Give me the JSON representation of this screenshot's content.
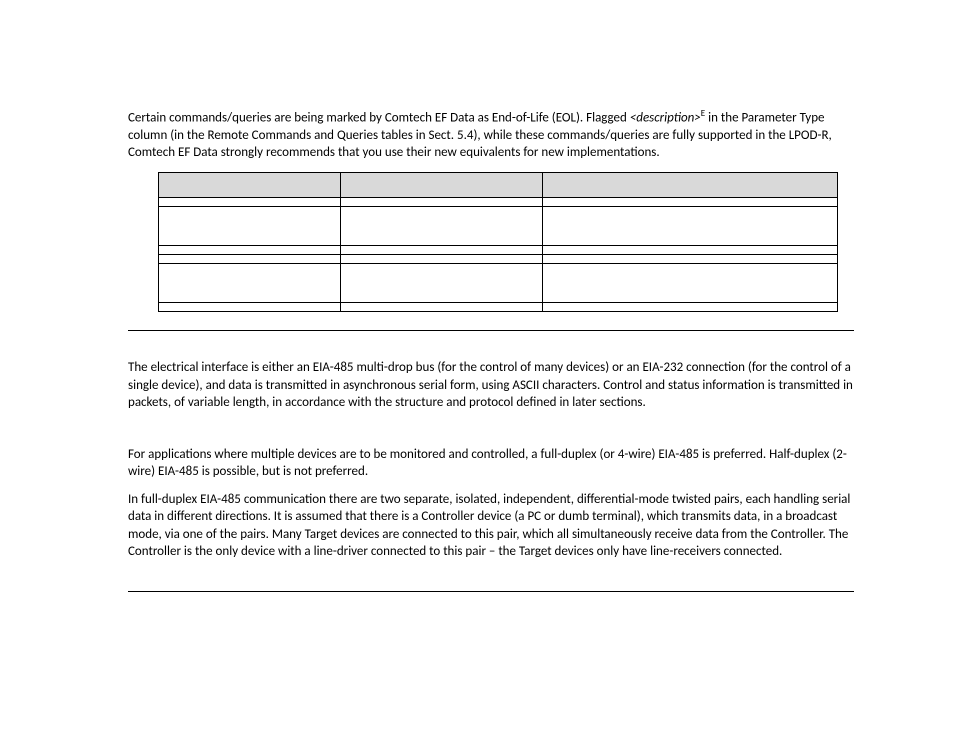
{
  "intro": {
    "line1a": "Certain commands/queries are being marked by Comtech EF Data as End-of-Life (EOL). Flagged ",
    "line1b": "<description>",
    "line1c": "E",
    "line1d": " in the Parameter Type column (in the Remote Commands and Queries tables in Sect. 5.4), while these commands/queries are fully supported in the LPOD-R, Comtech EF Data strongly recommends that you use their new equivalents for new implementations."
  },
  "table": {
    "headers": [
      "",
      "",
      ""
    ],
    "rows": [
      [
        "",
        "",
        ""
      ],
      [
        "",
        "",
        ""
      ],
      [
        "",
        "",
        ""
      ],
      [
        "",
        "",
        ""
      ],
      [
        "",
        "",
        ""
      ],
      [
        "",
        "",
        ""
      ]
    ]
  },
  "section2": {
    "p1": "The electrical interface is either an EIA-485 multi-drop bus (for the control of many devices) or an EIA-232 connection (for the control of a single device), and data is transmitted in asynchronous serial form, using ASCII characters. Control and status information is transmitted in packets, of variable length, in accordance with the structure and protocol defined in later sections."
  },
  "section3": {
    "p1": "For applications where multiple devices are to be monitored and controlled, a full-duplex (or 4-wire) EIA-485 is preferred. Half-duplex (2-wire) EIA-485 is possible, but is not preferred.",
    "p2": "In full-duplex EIA-485 communication there are two separate, isolated, independent, differential-mode twisted pairs, each handling serial data in different directions. It is assumed that there is a Controller device (a PC or dumb terminal), which transmits data, in a broadcast mode, via one of the pairs. Many Target devices are connected to this pair, which all simultaneously receive data from the Controller. The Controller is the only device with a line-driver connected to this pair – the Target devices only have line-receivers connected."
  }
}
